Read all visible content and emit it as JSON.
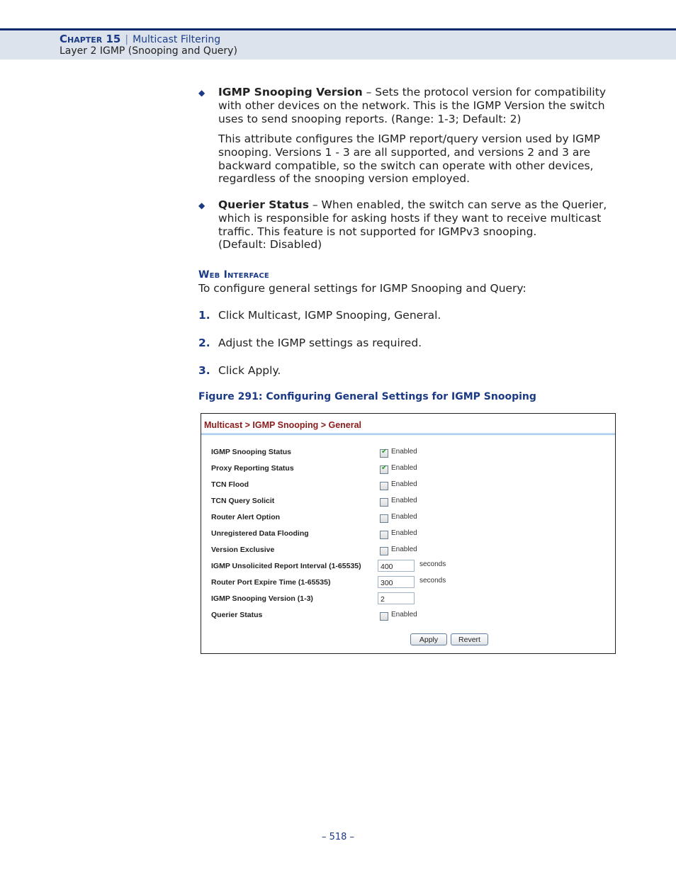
{
  "header": {
    "chapter_label": "Chapter 15",
    "separator": "|",
    "chapter_title": "Multicast Filtering",
    "section": "Layer 2 IGMP (Snooping and Query)"
  },
  "bullets": [
    {
      "term": "IGMP Snooping Version",
      "lines": [
        " – Sets the protocol version for compatibility",
        "with other devices on the network. This is the IGMP Version the switch",
        "uses to send snooping reports. (Range: 1-3; Default: 2)"
      ],
      "extra_lines": [
        "This attribute configures the IGMP report/query version used by IGMP",
        "snooping. Versions 1 - 3 are all supported, and versions 2 and 3 are",
        "backward compatible, so the switch can operate with other devices,",
        "regardless of the snooping version employed."
      ]
    },
    {
      "term": "Querier Status",
      "lines": [
        " – When enabled, the switch can serve as the Querier,",
        "which is responsible for asking hosts if they want to receive multicast",
        "traffic. This feature is not supported for IGMPv3 snooping.",
        "(Default: Disabled)"
      ]
    }
  ],
  "web_interface": {
    "heading": "Web Interface",
    "intro": "To configure general settings for IGMP Snooping and Query:",
    "steps": [
      {
        "num": "1.",
        "text": "Click Multicast, IGMP Snooping, General."
      },
      {
        "num": "2.",
        "text": "Adjust the IGMP settings as required."
      },
      {
        "num": "3.",
        "text": "Click Apply."
      }
    ],
    "figure_caption": "Figure 291:  Configuring General Settings for IGMP Snooping"
  },
  "figure": {
    "breadcrumb": "Multicast > IGMP Snooping > General",
    "enabled_label": "Enabled",
    "seconds_label": "seconds",
    "rows": [
      {
        "label": "IGMP Snooping Status",
        "type": "checkbox",
        "checked": true
      },
      {
        "label": "Proxy Reporting Status",
        "type": "checkbox",
        "checked": true
      },
      {
        "label": "TCN Flood",
        "type": "checkbox",
        "checked": false
      },
      {
        "label": "TCN Query Solicit",
        "type": "checkbox",
        "checked": false
      },
      {
        "label": "Router Alert Option",
        "type": "checkbox",
        "checked": false
      },
      {
        "label": "Unregistered Data Flooding",
        "type": "checkbox",
        "checked": false
      },
      {
        "label": "Version Exclusive",
        "type": "checkbox",
        "checked": false
      },
      {
        "label": "IGMP Unsolicited Report Interval (1-65535)",
        "type": "text",
        "value": "400",
        "unit": true
      },
      {
        "label": "Router Port Expire Time (1-65535)",
        "type": "text",
        "value": "300",
        "unit": true
      },
      {
        "label": "IGMP Snooping Version (1-3)",
        "type": "text",
        "value": "2",
        "unit": false
      },
      {
        "label": "Querier Status",
        "type": "checkbox",
        "checked": false
      }
    ],
    "apply_label": "Apply",
    "revert_label": "Revert",
    "check_glyph": "✔"
  },
  "footer": {
    "page_number": "–  518  –"
  }
}
